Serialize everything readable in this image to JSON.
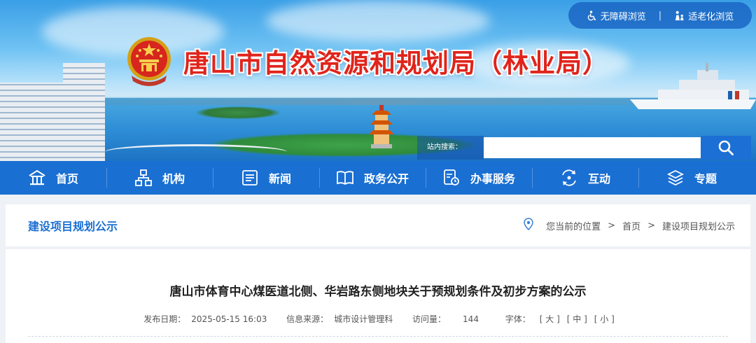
{
  "header": {
    "site_title": "唐山市自然资源和规划局（林业局）",
    "accessibility": {
      "barrier_free": "无障碍浏览",
      "separator": "|",
      "elder_mode": "适老化浏览"
    },
    "search": {
      "label": "站内搜索：",
      "value": "",
      "placeholder": ""
    }
  },
  "nav": {
    "items": [
      {
        "label": "首页",
        "icon": "home-icon"
      },
      {
        "label": "机构",
        "icon": "org-chart-icon"
      },
      {
        "label": "新闻",
        "icon": "news-icon"
      },
      {
        "label": "政务公开",
        "icon": "open-book-icon"
      },
      {
        "label": "办事服务",
        "icon": "service-icon"
      },
      {
        "label": "互动",
        "icon": "interaction-icon"
      },
      {
        "label": "专题",
        "icon": "layers-icon"
      }
    ]
  },
  "location": {
    "section_title": "建设项目规划公示",
    "prefix": "您当前的位置",
    "sep": ">",
    "crumbs": [
      "首页",
      "建设项目规划公示"
    ]
  },
  "article": {
    "title": "唐山市体育中心煤医道北侧、华岩路东侧地块关于预规划条件及初步方案的公示",
    "meta": {
      "date_label": "发布日期：",
      "date": "2025-05-15 16:03",
      "source_label": "信息来源：",
      "source": "城市设计管理科",
      "views_label": "访问量：",
      "views": "144",
      "font_label": "字体：",
      "font_large": "[ 大 ]",
      "font_medium": "[ 中 ]",
      "font_small": "[ 小 ]"
    }
  },
  "colors": {
    "primary": "#1a6fd2",
    "title_red": "#e0241b",
    "nav_bg": "#1a6fd2"
  }
}
